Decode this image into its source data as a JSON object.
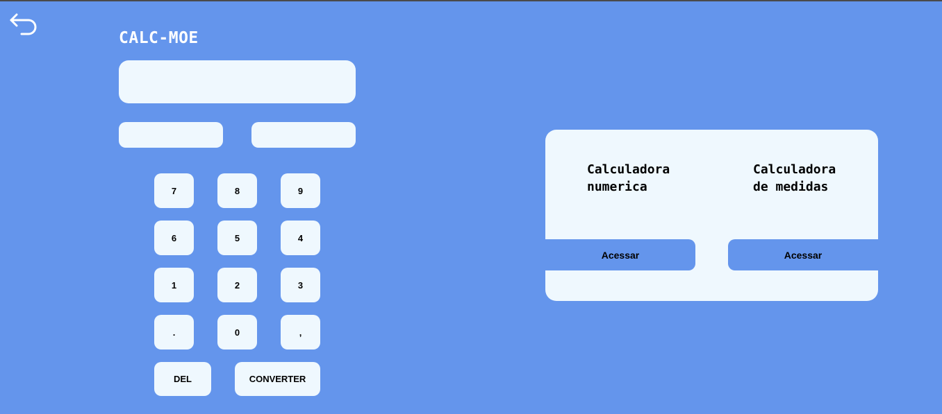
{
  "app": {
    "title": "CALC-MOE"
  },
  "converter": {
    "display_value": "",
    "unit_from_value": "",
    "unit_to_value": ""
  },
  "keypad": {
    "keys": [
      "7",
      "8",
      "9",
      "6",
      "5",
      "4",
      "1",
      "2",
      "3",
      ".",
      "0",
      ","
    ],
    "del_label": "DEL",
    "convert_label": "CONVERTER"
  },
  "calculators": {
    "numeric": {
      "line1": "Calculadora",
      "line2": "numerica",
      "button_label": "Acessar"
    },
    "measures": {
      "line1": "Calculadora",
      "line2": "de medidas",
      "button_label": "Acessar"
    }
  },
  "icons": {
    "back": "undo-arrow-icon"
  },
  "colors": {
    "background": "#6495ec",
    "surface": "#eff8fe",
    "title_text": "#ffffff"
  }
}
